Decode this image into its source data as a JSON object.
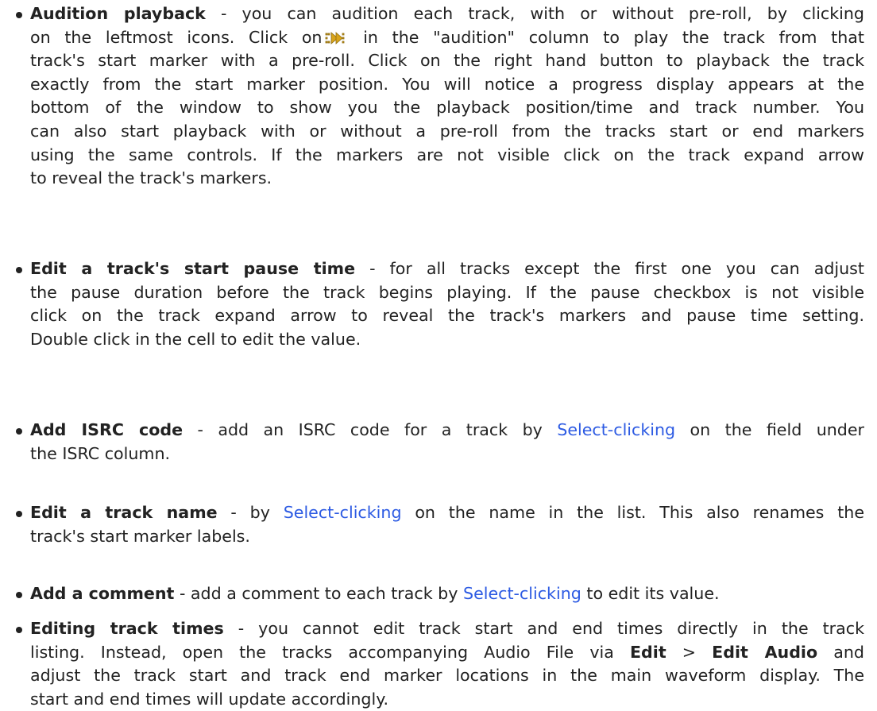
{
  "items": [
    {
      "title": "Audition playback",
      "line1_rest": " - you can audition each track, with or without pre-roll, by clicking",
      "line2_a": "on the leftmost icons. Click on",
      "line2_icon": "play-preroll-icon",
      "line2_b": " in the \"audition\" column to play the track from that",
      "line3": "track's start marker with a pre-roll. Click on the right hand button to playback the track",
      "line4": "exactly from the start marker position. You will notice a progress display appears at the",
      "line5": "bottom of the window to show you the playback position/time and track number. You",
      "line6": "can also start playback with or without a pre-roll from the tracks start or end markers",
      "line7": "using the same controls. If the markers are not visible click on the track expand arrow",
      "line8": "to reveal the track's markers."
    },
    {
      "title": "Edit a track's start pause time",
      "line1_rest": " - for all tracks except the first one you can adjust",
      "line2": "the pause duration before the track begins playing. If the pause checkbox is not visible",
      "line3": "click on the track expand arrow to reveal the track's markers and pause time setting.",
      "line4": "Double click in the cell to edit the value."
    },
    {
      "title": "Add ISRC code",
      "line1_a": " - add an ISRC code for a track by ",
      "link": "Select-clicking",
      "line1_b": " on the field under",
      "line2": "the ISRC column."
    },
    {
      "title": "Edit a track name",
      "line1_a": " - by ",
      "link": "Select-clicking",
      "line1_b": " on the name in the list. This also renames the",
      "line2": "track's start marker labels."
    },
    {
      "title": "Add a comment",
      "line1_a": " - add a comment to each track by ",
      "link": "Select-clicking",
      "line1_b": " to edit its value."
    },
    {
      "title": "Editing track times",
      "line1_rest": " - you cannot edit track start and end times directly in the track",
      "line2": "listing. Instead, open the tracks accompanying Audio File via ",
      "menu1": "Edit",
      "menu_sep": " > ",
      "menu2": "Edit Audio",
      "line2_b": " and",
      "line3": "adjust the track start and track end marker locations in the main waveform display. The",
      "line4": "start and end times will update accordingly."
    }
  ],
  "colors": {
    "text": "#222222",
    "link": "#2d5be3",
    "icon_body": "#d9a41b",
    "icon_outline": "#8a6a10"
  }
}
